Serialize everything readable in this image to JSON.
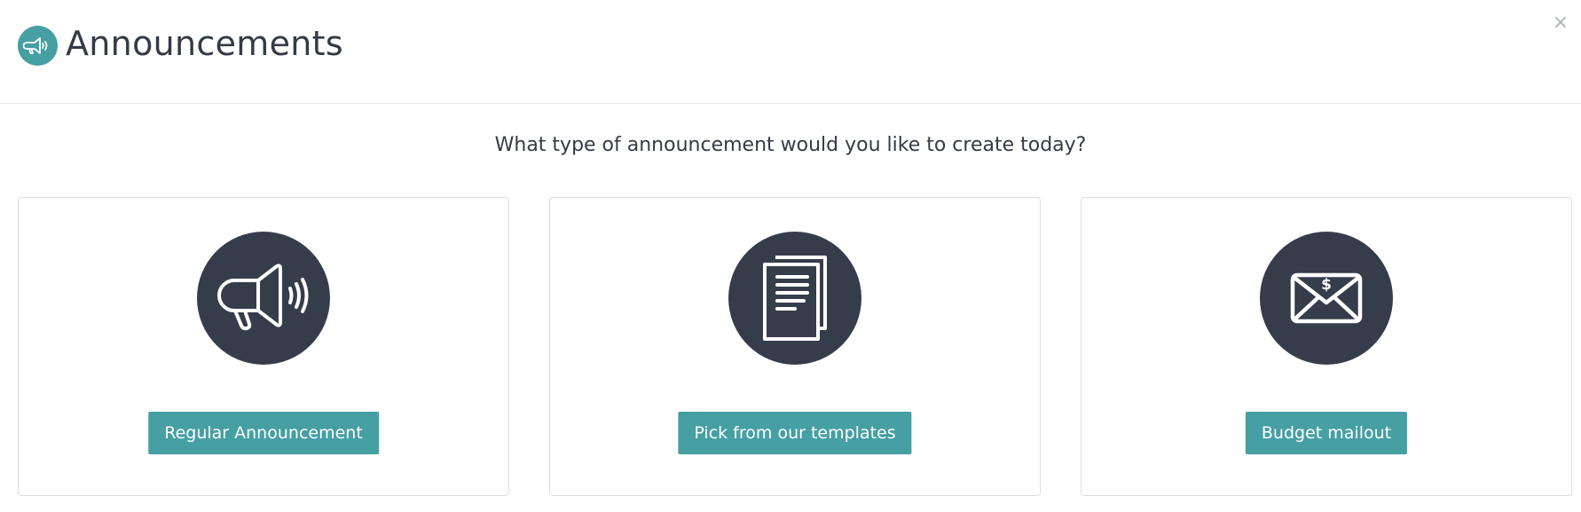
{
  "header": {
    "title": "Announcements",
    "icon": "megaphone-icon",
    "icon_bg": "#459fa3",
    "close_label": "×"
  },
  "question": "What type of announcement would you like to create today?",
  "cards": [
    {
      "icon": "megaphone-icon",
      "button_label": "Regular Announcement"
    },
    {
      "icon": "documents-icon",
      "button_label": "Pick from our templates"
    },
    {
      "icon": "envelope-dollar-icon",
      "button_label": "Budget mailout"
    }
  ],
  "colors": {
    "accent": "#459fa3",
    "circle": "#363d4a",
    "text": "#343a46"
  }
}
